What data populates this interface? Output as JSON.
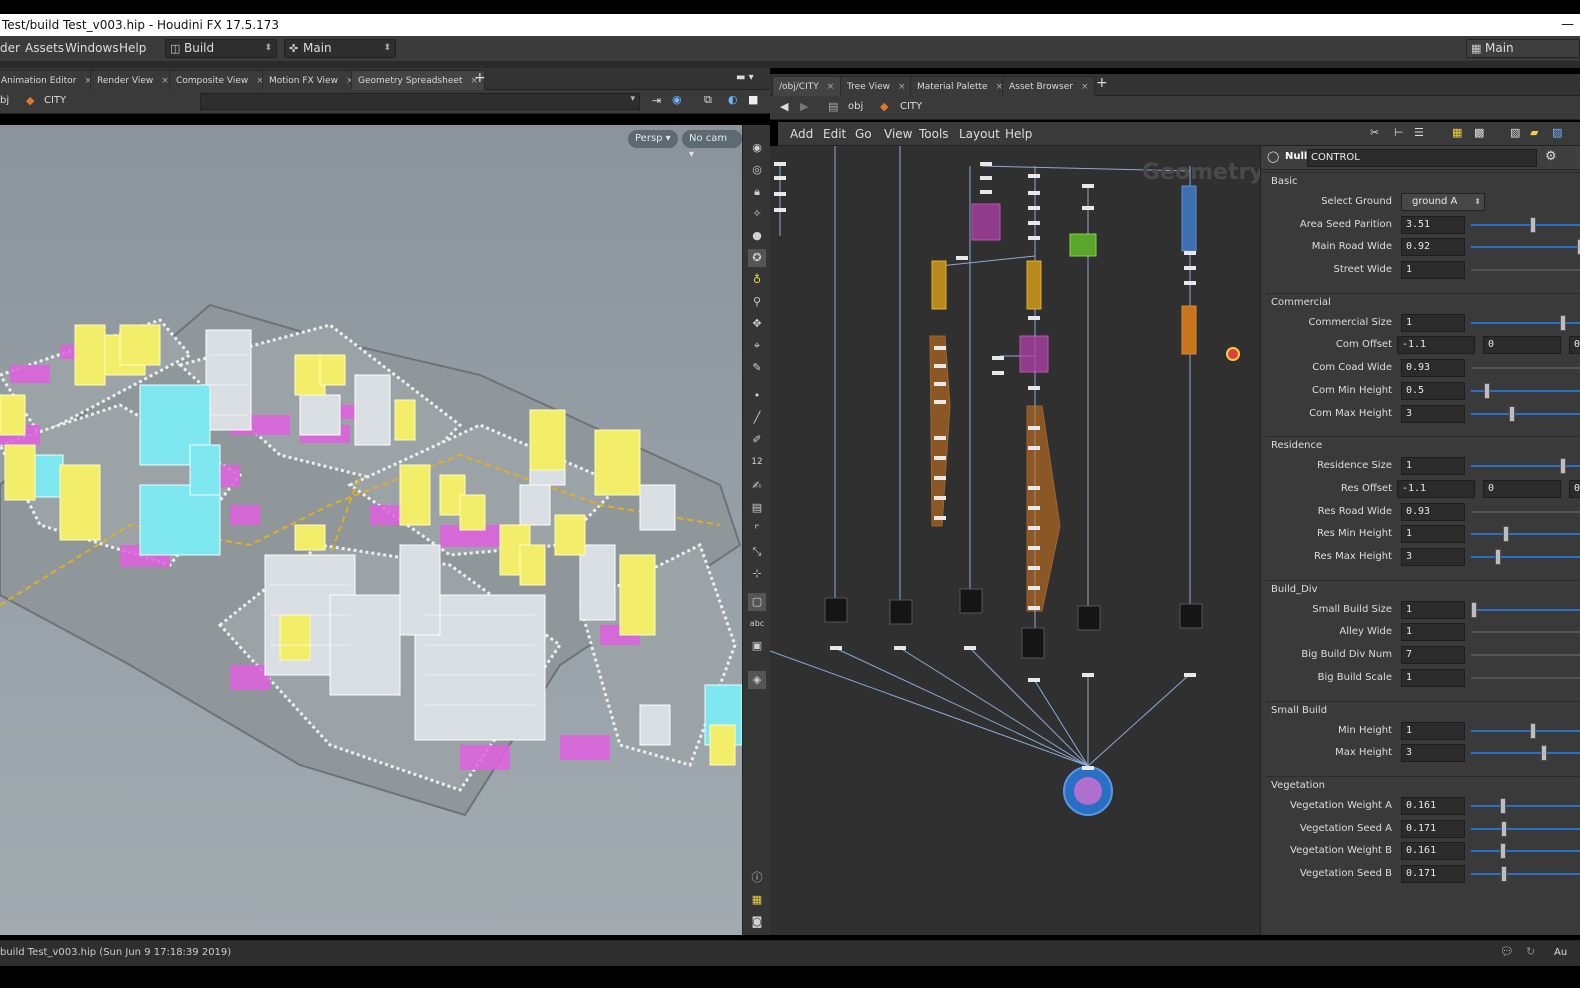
{
  "window": {
    "title": "Test/build Test_v003.hip - Houdini FX 17.5.173",
    "controls": "—"
  },
  "menubar": {
    "items": [
      "der",
      "Assets",
      "Windows",
      "Help"
    ],
    "desktop_combo": "Build",
    "shelf_combo": "Main",
    "right_desktop": "Main"
  },
  "left_panel": {
    "tabs": [
      "Animation Editor",
      "Render View",
      "Composite View",
      "Motion FX View",
      "Geometry Spreadsheet"
    ],
    "path": [
      "bj",
      "CITY"
    ],
    "camera_pills": [
      "Persp ▾",
      "No cam ▾"
    ]
  },
  "viewport_toolbar": {
    "text_tool": "abc",
    "num_tool": "12"
  },
  "right_panel": {
    "tabs": [
      "/obj/CITY",
      "Tree View",
      "Material Palette",
      "Asset Browser"
    ],
    "path": [
      "obj",
      "CITY"
    ],
    "network_menu": [
      "Add",
      "Edit",
      "Go",
      "View",
      "Tools",
      "Layout",
      "Help"
    ],
    "watermark": "Geometry"
  },
  "params": {
    "node_type": "Null",
    "node_name": "CONTROL",
    "sections": [
      {
        "title": "Basic",
        "rows": [
          {
            "label": "Select Ground",
            "value": "ground A",
            "kind": "select"
          },
          {
            "label": "Area Seed Parition",
            "value": "3.51",
            "knob": 0.55
          },
          {
            "label": "Main Road Wide",
            "value": "0.92",
            "knob": 0.98
          },
          {
            "label": "Street Wide",
            "value": "1",
            "knob": null
          }
        ]
      },
      {
        "title": "Commercial",
        "rows": [
          {
            "label": "Commercial Size",
            "value": "1",
            "knob": 0.82
          },
          {
            "label": "Com Offset",
            "value": "-1.1",
            "value2": "0",
            "value3": "0",
            "kind": "vec"
          },
          {
            "label": "Com Coad Wide",
            "value": "0.93",
            "knob": null
          },
          {
            "label": "Com Min Height",
            "value": "0.5",
            "knob": 0.12
          },
          {
            "label": "Com Max Height",
            "value": "3",
            "knob": 0.35
          }
        ]
      },
      {
        "title": "Residence",
        "rows": [
          {
            "label": "Residence Size",
            "value": "1",
            "knob": 0.82
          },
          {
            "label": "Res Offset",
            "value": "-1.1",
            "value2": "0",
            "value3": "0",
            "kind": "vec"
          },
          {
            "label": "Res Road Wide",
            "value": "0.93",
            "knob": null
          },
          {
            "label": "Res Min Height",
            "value": "1",
            "knob": 0.3
          },
          {
            "label": "Res Max Height",
            "value": "3",
            "knob": 0.22
          }
        ]
      },
      {
        "title": "Build_Div",
        "rows": [
          {
            "label": "Small Build Size",
            "value": "1",
            "knob": 0.0
          },
          {
            "label": "Alley Wide",
            "value": "1",
            "knob": null
          },
          {
            "label": "Big Build Div Num",
            "value": "7",
            "knob": null
          },
          {
            "label": "Big Build Scale",
            "value": "1",
            "knob": null
          }
        ]
      },
      {
        "title": "Small Build",
        "rows": [
          {
            "label": "Min Height",
            "value": "1",
            "knob": 0.55
          },
          {
            "label": "Max Height",
            "value": "3",
            "knob": 0.65
          }
        ]
      },
      {
        "title": "Vegetation",
        "rows": [
          {
            "label": "Vegetation Weight A",
            "value": "0.161",
            "knob": 0.27
          },
          {
            "label": "Vegetation Seed A",
            "value": "0.171",
            "knob": 0.28
          },
          {
            "label": "Vegetation Weight B",
            "value": "0.161",
            "knob": 0.27
          },
          {
            "label": "Vegetation Seed B",
            "value": "0.171",
            "knob": 0.28
          }
        ]
      }
    ]
  },
  "status": {
    "message": "build Test_v003.hip (Sun Jun  9 17:18:39 2019)",
    "right": "Au"
  },
  "colors": {
    "accent_blue": "#2a6fc4",
    "selection_magenta": "#e040e0",
    "yellow": "#f2ee6a",
    "cyan": "#7fe7f0"
  }
}
